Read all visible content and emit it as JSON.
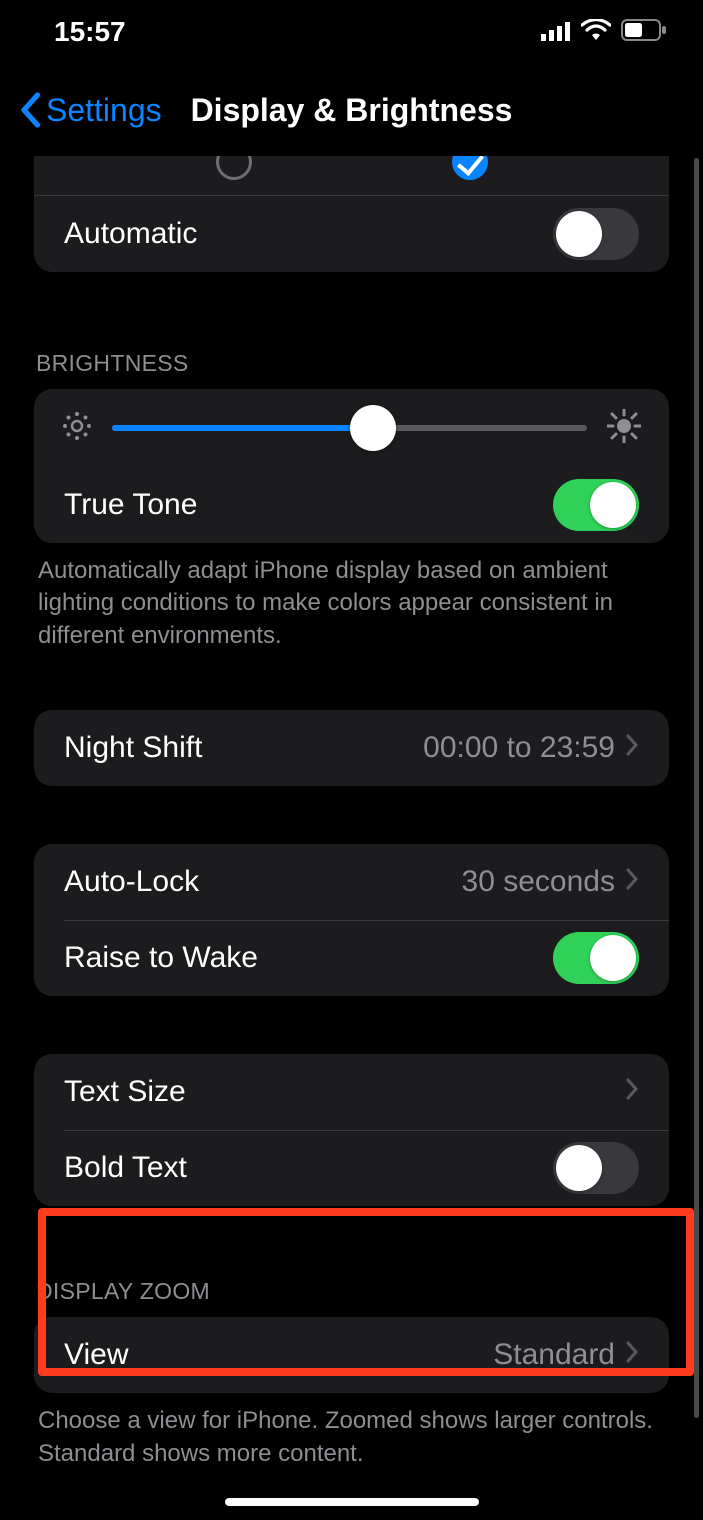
{
  "status": {
    "time": "15:57"
  },
  "nav": {
    "back_label": "Settings",
    "title": "Display & Brightness"
  },
  "appearance": {
    "light_selected": false,
    "dark_selected": true,
    "automatic_label": "Automatic",
    "automatic_on": false
  },
  "brightness": {
    "header": "BRIGHTNESS",
    "value_percent": 55,
    "true_tone_label": "True Tone",
    "true_tone_on": true,
    "footer": "Automatically adapt iPhone display based on ambient lighting conditions to make colors appear consistent in different environments."
  },
  "night_shift": {
    "label": "Night Shift",
    "value": "00:00 to 23:59"
  },
  "auto_lock": {
    "label": "Auto-Lock",
    "value": "30 seconds"
  },
  "raise_to_wake": {
    "label": "Raise to Wake",
    "on": true
  },
  "text_size": {
    "label": "Text Size"
  },
  "bold_text": {
    "label": "Bold Text",
    "on": false
  },
  "display_zoom": {
    "header": "DISPLAY ZOOM",
    "view_label": "View",
    "view_value": "Standard",
    "footer": "Choose a view for iPhone. Zoomed shows larger controls. Standard shows more content."
  }
}
